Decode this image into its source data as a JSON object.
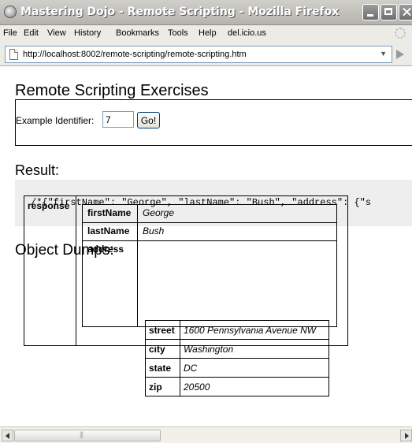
{
  "window": {
    "title": "Mastering Dojo - Remote Scripting - Mozilla Firefox"
  },
  "menu": [
    "File",
    "Edit",
    "View",
    "History",
    "Bookmarks",
    "Tools",
    "Help",
    "del.icio.us"
  ],
  "address_bar": {
    "url": "http://localhost:8002/remote-scripting/remote-scripting.htm"
  },
  "page": {
    "heading": "Remote Scripting Exercises",
    "form": {
      "label": "Example Identifier:",
      "value": "7",
      "button": "Go!"
    },
    "result_heading": "Result:",
    "result_text": "/*{\"firstName\": \"George\", \"lastName\": \"Bush\", \"address\": {\"s",
    "dumps_heading": "Object Dumps:"
  },
  "dump": {
    "key": "response",
    "rows": [
      {
        "key": "firstName",
        "value": "George"
      },
      {
        "key": "lastName",
        "value": "Bush"
      },
      {
        "key": "address"
      }
    ],
    "address": [
      {
        "key": "street",
        "value": "1600 Pennsylvania Avenue NW"
      },
      {
        "key": "city",
        "value": "Washington"
      },
      {
        "key": "state",
        "value": "DC"
      },
      {
        "key": "zip",
        "value": "20500"
      }
    ]
  }
}
